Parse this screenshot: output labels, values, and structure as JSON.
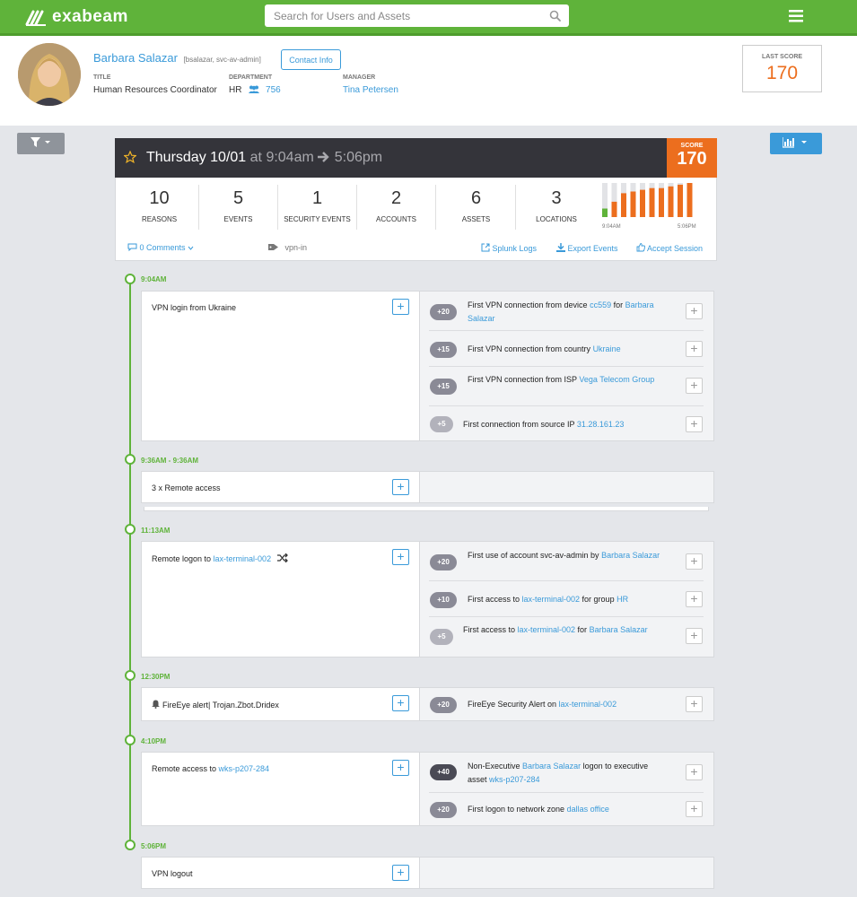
{
  "app": {
    "name": "exabeam"
  },
  "search": {
    "placeholder": "Search for Users and Assets"
  },
  "user": {
    "name": "Barbara Salazar",
    "accounts": "[bsalazar, svc-av-admin]",
    "contact_label": "Contact Info",
    "title_label": "TITLE",
    "title": "Human Resources Coordinator",
    "department_label": "DEPARTMENT",
    "department": "HR",
    "department_count": "756",
    "manager_label": "MANAGER",
    "manager": "Tina Petersen"
  },
  "last_score": {
    "label": "LAST SCORE",
    "value": "170"
  },
  "session": {
    "day": "Thursday 10/01",
    "at": "at",
    "start": "9:04am",
    "end": "5:06pm",
    "score_label": "SCORE",
    "score": "170"
  },
  "stats": [
    {
      "num": "10",
      "label": "REASONS"
    },
    {
      "num": "5",
      "label": "EVENTS"
    },
    {
      "num": "1",
      "label": "SECURITY EVENTS"
    },
    {
      "num": "2",
      "label": "ACCOUNTS"
    },
    {
      "num": "6",
      "label": "ASSETS"
    },
    {
      "num": "3",
      "label": "LOCATIONS"
    }
  ],
  "sparkline": {
    "start_label": "9:04AM",
    "end_label": "5:06PM",
    "fills": [
      0.25,
      0.45,
      0.7,
      0.75,
      0.8,
      0.85,
      0.85,
      0.9,
      0.95,
      1.0
    ],
    "colors": [
      "#5fb33a",
      "#ec6e1e",
      "#ec6e1e",
      "#ec6e1e",
      "#ec6e1e",
      "#ec6e1e",
      "#ec6e1e",
      "#ec6e1e",
      "#ec6e1e",
      "#ec6e1e"
    ]
  },
  "links": {
    "comments": "0 Comments",
    "tag": "vpn-in",
    "splunk": "Splunk Logs",
    "export": "Export Events",
    "accept": "Accept Session"
  },
  "timeline": {
    "t1": {
      "time": "9:04AM",
      "title": "VPN login from Ukraine",
      "reasons": [
        {
          "score": "+20",
          "pre": "First VPN connection from device ",
          "link": "cc559",
          "post": " for ",
          "link2": "Barbara Salazar"
        },
        {
          "score": "+15",
          "pre": "First VPN connection from country ",
          "link": "Ukraine"
        },
        {
          "score": "+15",
          "pre": "First VPN connection from ISP ",
          "link": "Vega Telecom Group"
        },
        {
          "score": "+5",
          "pre": "First connection from source IP ",
          "link": "31.28.161.23"
        }
      ]
    },
    "t2": {
      "time": "9:36AM - 9:36AM",
      "title": "3 x Remote access"
    },
    "t3": {
      "time": "11:13AM",
      "title_pre": "Remote logon to ",
      "title_link": "lax-terminal-002",
      "reasons": [
        {
          "score": "+20",
          "pre": "First use of account svc-av-admin by ",
          "link": "Barbara Salazar"
        },
        {
          "score": "+10",
          "pre": "First access to ",
          "link": "lax-terminal-002",
          "post": " for group ",
          "link2": "HR"
        },
        {
          "score": "+5",
          "pre": "First access to ",
          "link": "lax-terminal-002",
          "post": " for ",
          "link2": "Barbara Salazar"
        }
      ]
    },
    "t4": {
      "time": "12:30PM",
      "title": "FireEye alert| Trojan.Zbot.Dridex",
      "reasons": [
        {
          "score": "+20",
          "pre": "FireEye Security Alert on ",
          "link": "lax-terminal-002"
        }
      ]
    },
    "t5": {
      "time": "4:10PM",
      "title_pre": "Remote access to ",
      "title_link": "wks-p207-284",
      "reasons": [
        {
          "score": "+40",
          "pre": "Non-Executive ",
          "link": "Barbara Salazar",
          "post": " logon to executive asset ",
          "link2": "wks-p207-284"
        },
        {
          "score": "+20",
          "pre": "First logon to network zone ",
          "link": "dallas office"
        }
      ]
    },
    "t6": {
      "time": "5:06PM",
      "title": "VPN logout"
    }
  }
}
